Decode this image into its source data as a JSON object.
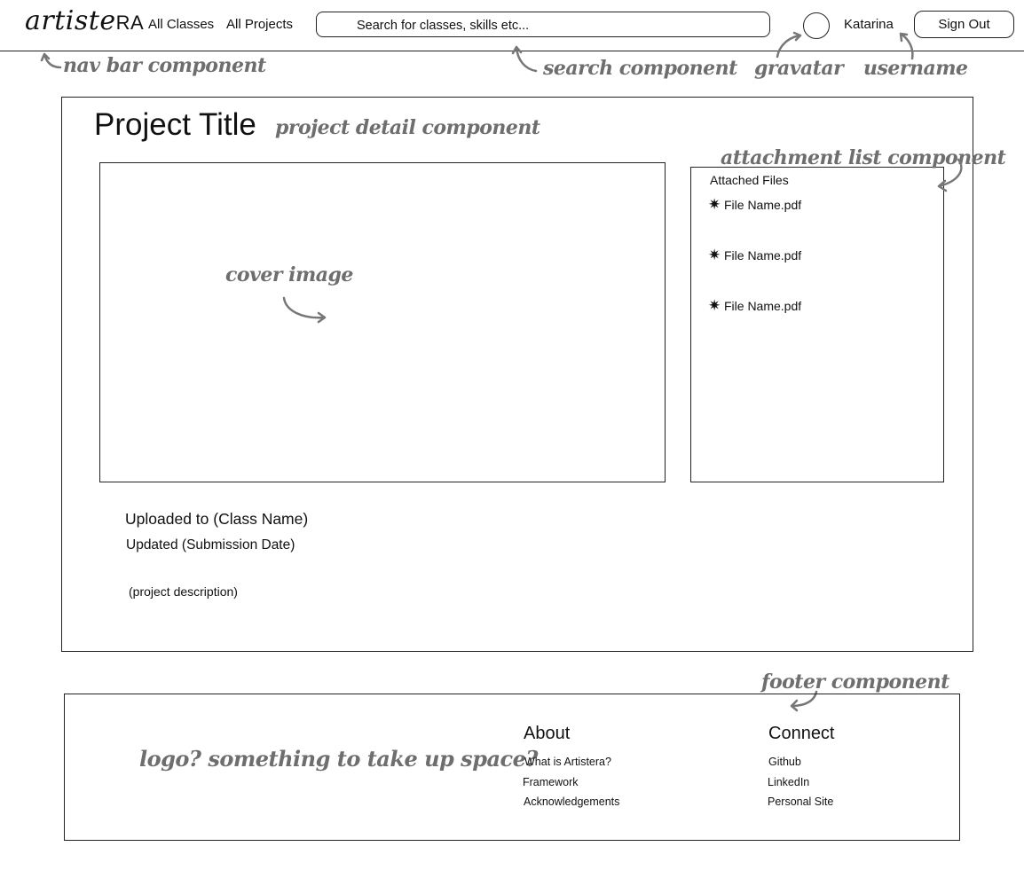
{
  "nav": {
    "logo_text": "artiste",
    "logo_suffix": "RA",
    "links": [
      "All Classes",
      "All Projects"
    ],
    "search_placeholder": "Search for classes, skills etc...",
    "username": "Katarina",
    "signout_label": "Sign Out"
  },
  "annotations": {
    "nav_bar": "nav bar component",
    "search": "search component",
    "gravatar": "gravatar",
    "username": "username",
    "project_detail": "project detail component",
    "attachment_list": "attachment list component",
    "cover_image": "cover image",
    "footer": "footer component",
    "footer_logo": "logo? something to take up space?"
  },
  "project": {
    "title": "Project Title",
    "uploaded_to": "Uploaded to (Class Name)",
    "updated": "Updated (Submission Date)",
    "description": "(project description)"
  },
  "attachments": {
    "title": "Attached Files",
    "files": [
      "File Name.pdf",
      "File Name.pdf",
      "File Name.pdf"
    ],
    "file_icon": "starburst-icon"
  },
  "footer": {
    "about": {
      "heading": "About",
      "links": [
        "What is Artistera?",
        "Framework",
        "Acknowledgements"
      ]
    },
    "connect": {
      "heading": "Connect",
      "links": [
        "Github",
        "LinkedIn",
        "Personal Site"
      ]
    }
  },
  "colors": {
    "line": "#222222",
    "annotation": "#6e6e6e"
  }
}
